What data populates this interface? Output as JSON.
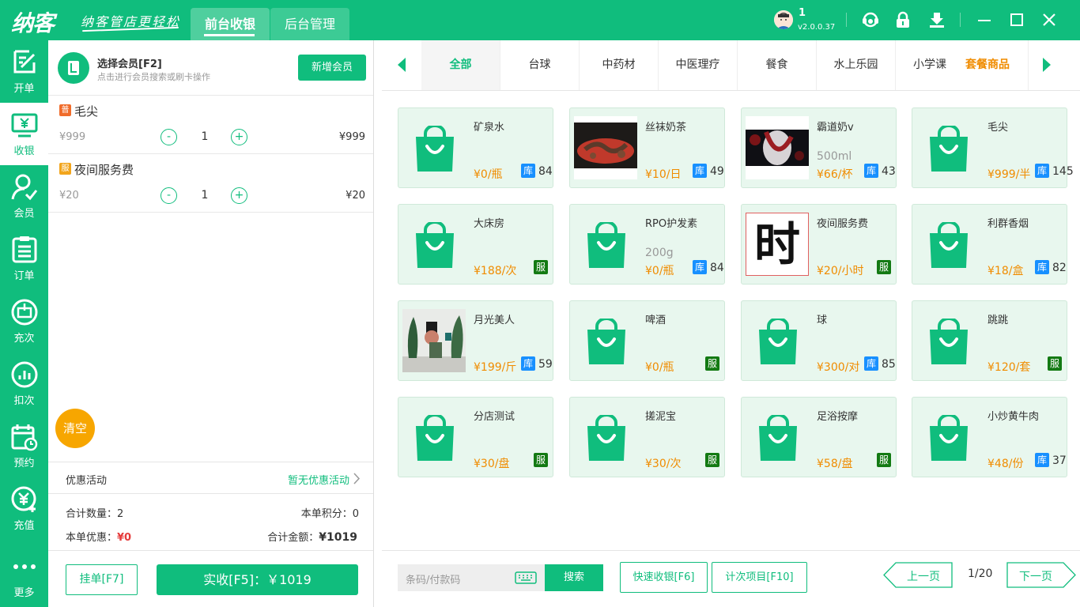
{
  "topbar": {
    "logo": "纳客",
    "slogan": "纳客管店更轻松",
    "tabs": [
      {
        "label": "前台收银",
        "active": true
      },
      {
        "label": "后台管理",
        "active": false
      }
    ],
    "user": "1",
    "version": "v2.0.0.37",
    "icons": [
      "headset-icon",
      "lock-icon",
      "download-icon",
      "minimize-icon",
      "maximize-icon",
      "close-icon"
    ]
  },
  "sidebar": {
    "items": [
      {
        "label": "开单",
        "icon": "edit-icon"
      },
      {
        "label": "收银",
        "icon": "cashier-icon",
        "active": true
      },
      {
        "label": "会员",
        "icon": "member-icon"
      },
      {
        "label": "订单",
        "icon": "order-icon"
      },
      {
        "label": "充次",
        "icon": "recharge-times-icon"
      },
      {
        "label": "扣次",
        "icon": "deduct-times-icon"
      },
      {
        "label": "预约",
        "icon": "appointment-icon"
      },
      {
        "label": "充值",
        "icon": "recharge-icon"
      },
      {
        "label": "更多",
        "icon": "more-icon"
      }
    ]
  },
  "member": {
    "title": "选择会员[F2]",
    "subtitle": "点击进行会员搜索或刷卡操作",
    "add_button": "新增会员"
  },
  "cart": {
    "items": [
      {
        "badge": "普",
        "badge_color": "#f06c2b",
        "name": "毛尖",
        "unit_price": "¥999",
        "minus": "-",
        "qty": "1",
        "plus": "+",
        "subtotal": "¥999"
      },
      {
        "badge": "服",
        "badge_color": "#f2a51c",
        "name": "夜间服务费",
        "unit_price": "¥20",
        "minus": "-",
        "qty": "1",
        "plus": "+",
        "subtotal": "¥20"
      }
    ],
    "clear_label": "清空"
  },
  "promo": {
    "label": "优惠活动",
    "value": "暂无优惠活动"
  },
  "summary": {
    "qty_label": "合计数量：",
    "qty": "2",
    "points_label": "本单积分：",
    "points": "0",
    "discount_label": "本单优惠：",
    "discount": "¥0",
    "total_label": "合计金额：",
    "total": "¥1019"
  },
  "actions": {
    "hold": "挂单[F7]",
    "pay": "实收[F5]：￥1019"
  },
  "categories": {
    "items": [
      "全部",
      "台球",
      "中药材",
      "中医理疗",
      "餐食",
      "水上乐园",
      "小学课",
      "套餐商品"
    ],
    "active": "全部"
  },
  "products": [
    {
      "name": "矿泉水",
      "price": "¥0/瓶",
      "tag": "库",
      "stock": "84",
      "img": "bag"
    },
    {
      "name": "丝袜奶茶",
      "price": "¥10/日",
      "tag": "库",
      "stock": "49",
      "img": "food"
    },
    {
      "name": "霸道奶v",
      "spec": "500ml",
      "price": "¥66/杯",
      "tag": "库",
      "stock": "43",
      "img": "art"
    },
    {
      "name": "毛尖",
      "price": "¥999/半",
      "tag": "库",
      "stock": "145",
      "img": "bag"
    },
    {
      "name": "大床房",
      "price": "¥188/次",
      "tag": "服",
      "stock": "",
      "img": "bag"
    },
    {
      "name": "RPO护发素",
      "spec": "200g",
      "price": "¥0/瓶",
      "tag": "库",
      "stock": "84",
      "img": "bag"
    },
    {
      "name": "夜间服务费",
      "price": "¥20/小时",
      "tag": "服",
      "stock": "",
      "img": "char",
      "char": "时"
    },
    {
      "name": "利群香烟",
      "price": "¥18/盒",
      "tag": "库",
      "stock": "82",
      "img": "bag"
    },
    {
      "name": "月光美人",
      "price": "¥199/斤",
      "tag": "库",
      "stock": "59",
      "img": "room"
    },
    {
      "name": "啤酒",
      "price": "¥0/瓶",
      "tag": "服",
      "stock": "",
      "img": "bag"
    },
    {
      "name": "球",
      "price": "¥300/对",
      "tag": "库",
      "stock": "85",
      "img": "bag"
    },
    {
      "name": "跳跳",
      "price": "¥120/套",
      "tag": "服",
      "stock": "",
      "img": "bag"
    },
    {
      "name": "分店测试",
      "price": "¥30/盘",
      "tag": "服",
      "stock": "",
      "img": "bag"
    },
    {
      "name": "搓泥宝",
      "price": "¥30/次",
      "tag": "服",
      "stock": "",
      "img": "bag"
    },
    {
      "name": "足浴按摩",
      "price": "¥58/盘",
      "tag": "服",
      "stock": "",
      "img": "bag"
    },
    {
      "name": "小炒黄牛肉",
      "price": "¥48/份",
      "tag": "库",
      "stock": "37",
      "img": "bag"
    }
  ],
  "footer": {
    "barcode_placeholder": "条码/付款码",
    "search": "搜索",
    "quick_pay": "快速收银[F6]",
    "count_items": "计次项目[F10]",
    "prev": "上一页",
    "page": "1/20",
    "next": "下一页"
  }
}
